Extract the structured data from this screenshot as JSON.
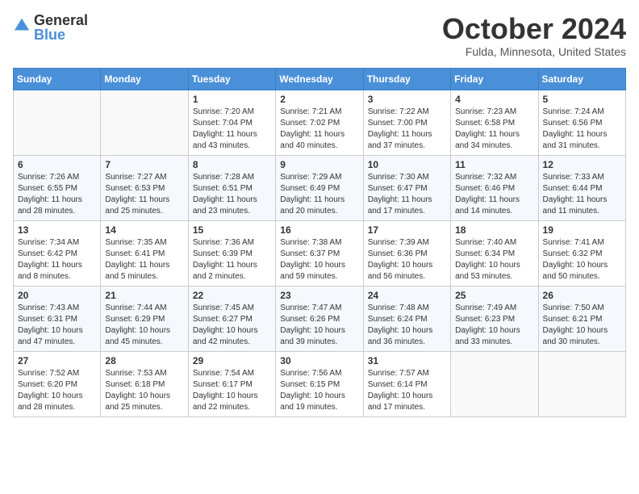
{
  "header": {
    "logo_general": "General",
    "logo_blue": "Blue",
    "month_title": "October 2024",
    "location": "Fulda, Minnesota, United States"
  },
  "days_of_week": [
    "Sunday",
    "Monday",
    "Tuesday",
    "Wednesday",
    "Thursday",
    "Friday",
    "Saturday"
  ],
  "weeks": [
    [
      {
        "day": "",
        "sunrise": "",
        "sunset": "",
        "daylight": ""
      },
      {
        "day": "",
        "sunrise": "",
        "sunset": "",
        "daylight": ""
      },
      {
        "day": "1",
        "sunrise": "Sunrise: 7:20 AM",
        "sunset": "Sunset: 7:04 PM",
        "daylight": "Daylight: 11 hours and 43 minutes."
      },
      {
        "day": "2",
        "sunrise": "Sunrise: 7:21 AM",
        "sunset": "Sunset: 7:02 PM",
        "daylight": "Daylight: 11 hours and 40 minutes."
      },
      {
        "day": "3",
        "sunrise": "Sunrise: 7:22 AM",
        "sunset": "Sunset: 7:00 PM",
        "daylight": "Daylight: 11 hours and 37 minutes."
      },
      {
        "day": "4",
        "sunrise": "Sunrise: 7:23 AM",
        "sunset": "Sunset: 6:58 PM",
        "daylight": "Daylight: 11 hours and 34 minutes."
      },
      {
        "day": "5",
        "sunrise": "Sunrise: 7:24 AM",
        "sunset": "Sunset: 6:56 PM",
        "daylight": "Daylight: 11 hours and 31 minutes."
      }
    ],
    [
      {
        "day": "6",
        "sunrise": "Sunrise: 7:26 AM",
        "sunset": "Sunset: 6:55 PM",
        "daylight": "Daylight: 11 hours and 28 minutes."
      },
      {
        "day": "7",
        "sunrise": "Sunrise: 7:27 AM",
        "sunset": "Sunset: 6:53 PM",
        "daylight": "Daylight: 11 hours and 25 minutes."
      },
      {
        "day": "8",
        "sunrise": "Sunrise: 7:28 AM",
        "sunset": "Sunset: 6:51 PM",
        "daylight": "Daylight: 11 hours and 23 minutes."
      },
      {
        "day": "9",
        "sunrise": "Sunrise: 7:29 AM",
        "sunset": "Sunset: 6:49 PM",
        "daylight": "Daylight: 11 hours and 20 minutes."
      },
      {
        "day": "10",
        "sunrise": "Sunrise: 7:30 AM",
        "sunset": "Sunset: 6:47 PM",
        "daylight": "Daylight: 11 hours and 17 minutes."
      },
      {
        "day": "11",
        "sunrise": "Sunrise: 7:32 AM",
        "sunset": "Sunset: 6:46 PM",
        "daylight": "Daylight: 11 hours and 14 minutes."
      },
      {
        "day": "12",
        "sunrise": "Sunrise: 7:33 AM",
        "sunset": "Sunset: 6:44 PM",
        "daylight": "Daylight: 11 hours and 11 minutes."
      }
    ],
    [
      {
        "day": "13",
        "sunrise": "Sunrise: 7:34 AM",
        "sunset": "Sunset: 6:42 PM",
        "daylight": "Daylight: 11 hours and 8 minutes."
      },
      {
        "day": "14",
        "sunrise": "Sunrise: 7:35 AM",
        "sunset": "Sunset: 6:41 PM",
        "daylight": "Daylight: 11 hours and 5 minutes."
      },
      {
        "day": "15",
        "sunrise": "Sunrise: 7:36 AM",
        "sunset": "Sunset: 6:39 PM",
        "daylight": "Daylight: 11 hours and 2 minutes."
      },
      {
        "day": "16",
        "sunrise": "Sunrise: 7:38 AM",
        "sunset": "Sunset: 6:37 PM",
        "daylight": "Daylight: 10 hours and 59 minutes."
      },
      {
        "day": "17",
        "sunrise": "Sunrise: 7:39 AM",
        "sunset": "Sunset: 6:36 PM",
        "daylight": "Daylight: 10 hours and 56 minutes."
      },
      {
        "day": "18",
        "sunrise": "Sunrise: 7:40 AM",
        "sunset": "Sunset: 6:34 PM",
        "daylight": "Daylight: 10 hours and 53 minutes."
      },
      {
        "day": "19",
        "sunrise": "Sunrise: 7:41 AM",
        "sunset": "Sunset: 6:32 PM",
        "daylight": "Daylight: 10 hours and 50 minutes."
      }
    ],
    [
      {
        "day": "20",
        "sunrise": "Sunrise: 7:43 AM",
        "sunset": "Sunset: 6:31 PM",
        "daylight": "Daylight: 10 hours and 47 minutes."
      },
      {
        "day": "21",
        "sunrise": "Sunrise: 7:44 AM",
        "sunset": "Sunset: 6:29 PM",
        "daylight": "Daylight: 10 hours and 45 minutes."
      },
      {
        "day": "22",
        "sunrise": "Sunrise: 7:45 AM",
        "sunset": "Sunset: 6:27 PM",
        "daylight": "Daylight: 10 hours and 42 minutes."
      },
      {
        "day": "23",
        "sunrise": "Sunrise: 7:47 AM",
        "sunset": "Sunset: 6:26 PM",
        "daylight": "Daylight: 10 hours and 39 minutes."
      },
      {
        "day": "24",
        "sunrise": "Sunrise: 7:48 AM",
        "sunset": "Sunset: 6:24 PM",
        "daylight": "Daylight: 10 hours and 36 minutes."
      },
      {
        "day": "25",
        "sunrise": "Sunrise: 7:49 AM",
        "sunset": "Sunset: 6:23 PM",
        "daylight": "Daylight: 10 hours and 33 minutes."
      },
      {
        "day": "26",
        "sunrise": "Sunrise: 7:50 AM",
        "sunset": "Sunset: 6:21 PM",
        "daylight": "Daylight: 10 hours and 30 minutes."
      }
    ],
    [
      {
        "day": "27",
        "sunrise": "Sunrise: 7:52 AM",
        "sunset": "Sunset: 6:20 PM",
        "daylight": "Daylight: 10 hours and 28 minutes."
      },
      {
        "day": "28",
        "sunrise": "Sunrise: 7:53 AM",
        "sunset": "Sunset: 6:18 PM",
        "daylight": "Daylight: 10 hours and 25 minutes."
      },
      {
        "day": "29",
        "sunrise": "Sunrise: 7:54 AM",
        "sunset": "Sunset: 6:17 PM",
        "daylight": "Daylight: 10 hours and 22 minutes."
      },
      {
        "day": "30",
        "sunrise": "Sunrise: 7:56 AM",
        "sunset": "Sunset: 6:15 PM",
        "daylight": "Daylight: 10 hours and 19 minutes."
      },
      {
        "day": "31",
        "sunrise": "Sunrise: 7:57 AM",
        "sunset": "Sunset: 6:14 PM",
        "daylight": "Daylight: 10 hours and 17 minutes."
      },
      {
        "day": "",
        "sunrise": "",
        "sunset": "",
        "daylight": ""
      },
      {
        "day": "",
        "sunrise": "",
        "sunset": "",
        "daylight": ""
      }
    ]
  ]
}
